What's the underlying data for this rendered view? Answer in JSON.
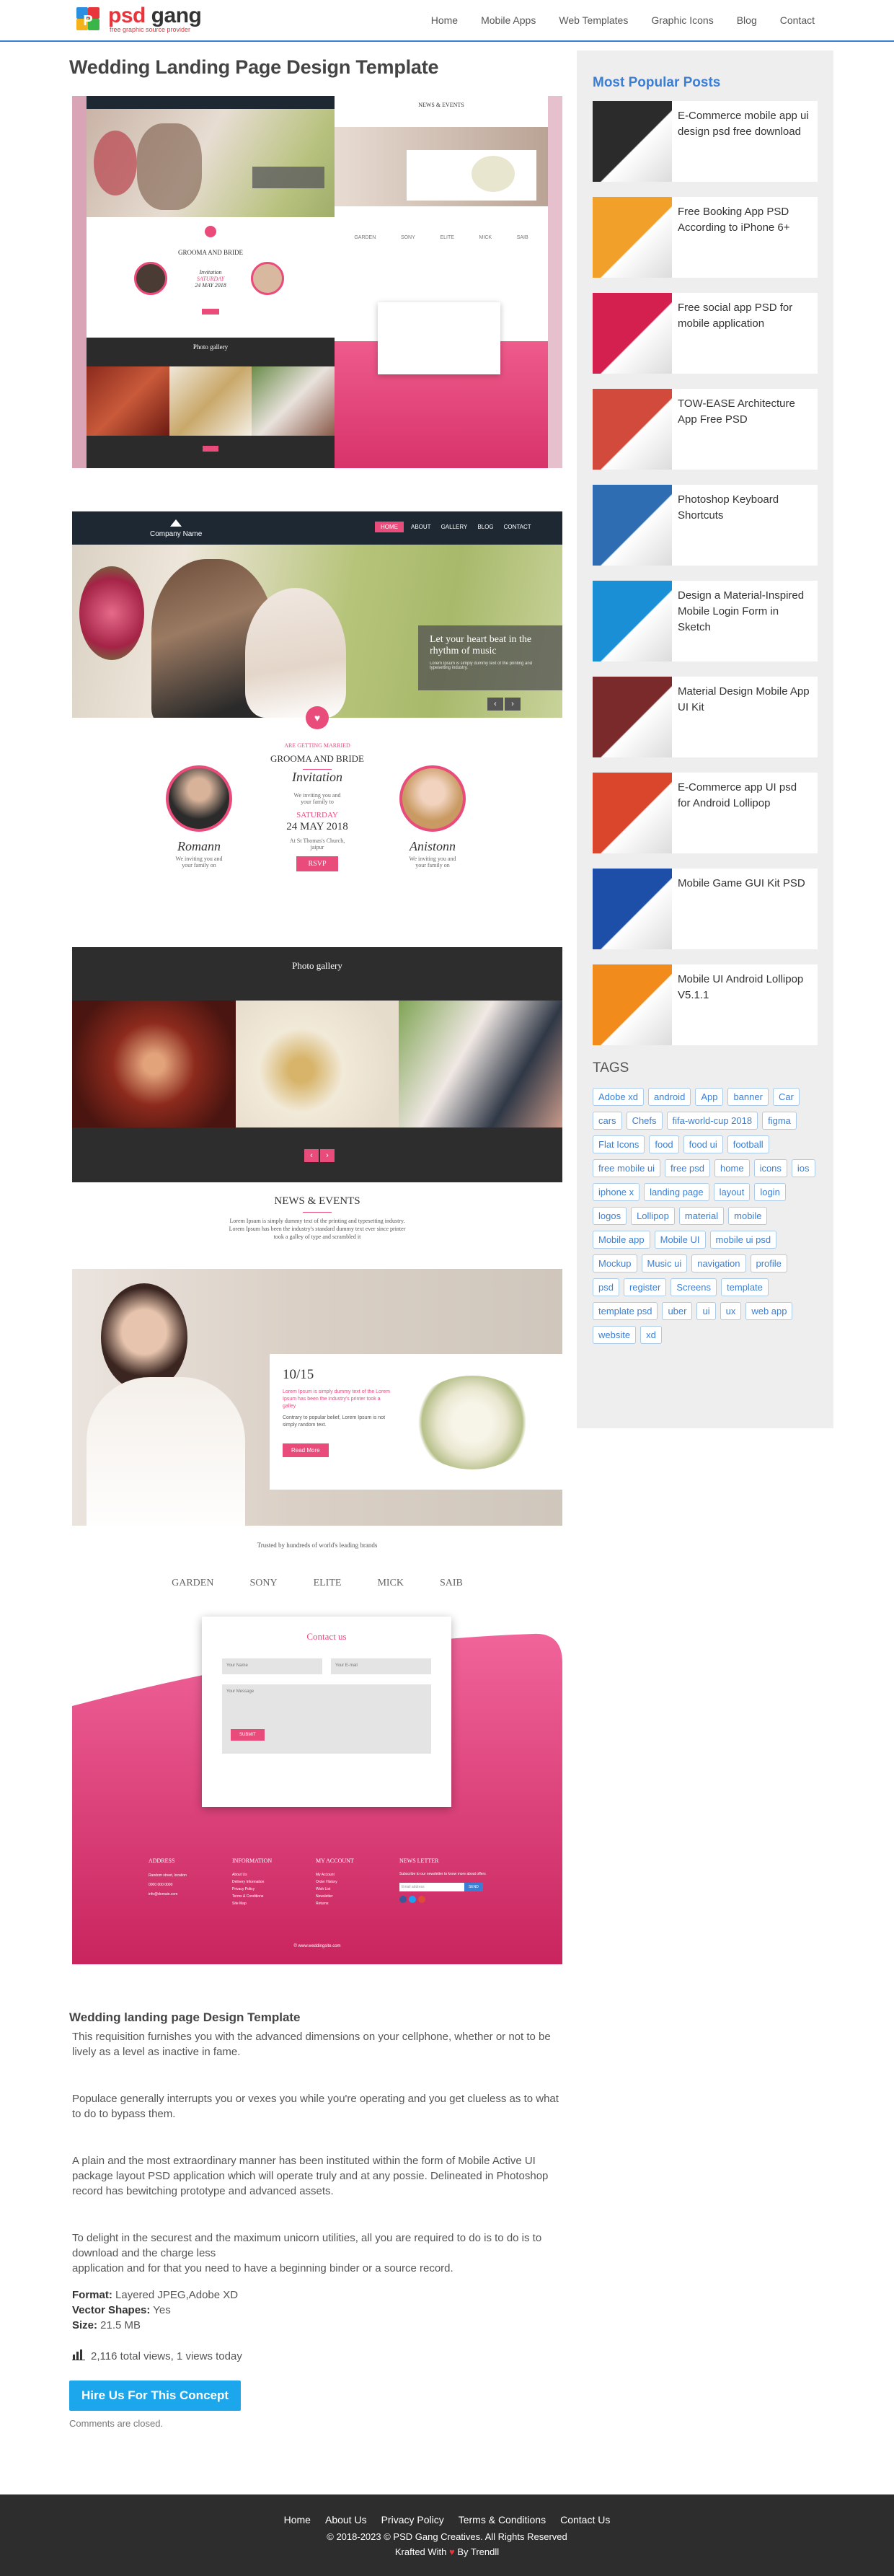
{
  "header": {
    "logo": {
      "name_part1": "psd",
      "name_part2": " gang",
      "tagline": "free graphic source provider"
    },
    "nav": [
      "Home",
      "Mobile Apps",
      "Web Templates",
      "Graphic Icons",
      "Blog",
      "Contact"
    ]
  },
  "main": {
    "title": "Wedding Landing Page Design Template"
  },
  "mockup": {
    "brand": "Company Name",
    "menu": [
      "HOME",
      "ABOUT",
      "GALLERY",
      "BLOG",
      "CONTACT"
    ],
    "hero_text": "Let your heart beat in the rhythm of music",
    "hero_sub": "Lorem Ipsum is simply dummy text of the printing and typesetting industry.",
    "kicker": "ARE GETTING MARRIED",
    "couple_title": "GROOMA AND BRIDE",
    "invitation": "Invitation",
    "invite_line": "We inviting you and your family to",
    "day": "SATURDAY",
    "date": "24 MAY 2018",
    "venue": "At St Thomas's Church, jaipur",
    "rsvp": "RSVP",
    "groom_name": "Romann",
    "bride_name": "Anistonn",
    "name_sub": "We inviting you and your family on",
    "gallery_title": "Photo gallery",
    "news_title": "NEWS & EVENTS",
    "news_text": "Lorem Ipsum is simply dummy text of the printing and typesetting industry. Lorem Ipsum has been the industry's standard dummy text ever since printer took a galley of type and scrambled it",
    "event_date": "10/15",
    "event_text": "Lorem Ipsum is simply dummy text of the Lorem Ipsum has been the industry's printer took a galley",
    "event_text2": "Contrary to popular belief, Lorem Ipsum is not simply random text.",
    "read_more": "Read More",
    "brands_title": "Trusted by hundreds of world's leading brands",
    "brands": [
      "GARDEN",
      "SONY",
      "ELITE",
      "MICK",
      "SAIB"
    ],
    "contact_title": "Contact us",
    "contact_fields": {
      "name": "Your Name",
      "email": "Your E-mail",
      "message": "Your Message"
    },
    "submit": "SUBMIT",
    "footer_cols": [
      {
        "h": "ADDRESS",
        "items": [
          "Random street, location",
          "0000 000 0000",
          "info@domain.com"
        ]
      },
      {
        "h": "INFORMATION",
        "items": [
          "About Us",
          "Delivery Information",
          "Privacy Policy",
          "Terms & Conditions",
          "Site Map"
        ]
      },
      {
        "h": "MY ACCOUNT",
        "items": [
          "My Account",
          "Order History",
          "Wish List",
          "Newsletter",
          "Returns"
        ]
      },
      {
        "h": "NEWS LETTER",
        "items": [
          "Subscribe to our newsletter to know more about offers"
        ]
      }
    ],
    "subscribe": "SEND",
    "email_ph": "Email address",
    "copyright": "© www.weddingsite.com"
  },
  "description": {
    "heading": "Wedding landing page Design Template",
    "paragraphs": [
      "This requisition furnishes you with the advanced dimensions on your cellphone, whether or not to be lively as a level as inactive in fame.",
      "Populace generally interrupts you or vexes you while you're operating and you get clueless as to what to do to bypass them.",
      "A plain and the most extraordinary manner has been instituted within the form of Mobile Active UI package layout PSD application which will operate truly and at any possie. Delineated in Photoshop record has bewitching prototype and advanced assets.",
      "To delight in the securest and the maximum unicorn utilities, all you are required to do is to do is to download and the charge less\napplication and for that you need to have a beginning binder or a source record."
    ],
    "format_label": "Format:",
    "format_value": " Layered JPEG,Adobe XD",
    "vector_label": "Vector Shapes:",
    "vector_value": " Yes",
    "size_label": "Size:",
    "size_value": " 21.5 MB",
    "views": "2,116 total views,  1 views today",
    "hire_button": "Hire Us For This Concept",
    "comments_closed": "Comments are closed."
  },
  "sidebar": {
    "popular_heading": "Most Popular Posts",
    "posts": [
      {
        "title": "E-Commerce mobile app ui design psd free download",
        "color": "#2b2b2b"
      },
      {
        "title": "Free Booking App PSD According to iPhone 6+",
        "color": "#f1a12a"
      },
      {
        "title": "Free social app PSD for mobile application",
        "color": "#d4204f"
      },
      {
        "title": "TOW-EASE Architecture App Free PSD",
        "color": "#d24a3b"
      },
      {
        "title": "Photoshop Keyboard Shortcuts",
        "color": "#2f6db3"
      },
      {
        "title": "Design a Material-Inspired Mobile Login Form in Sketch",
        "color": "#1b8fd6"
      },
      {
        "title": "Material Design Mobile App UI Kit",
        "color": "#7a2a2a"
      },
      {
        "title": "E-Commerce app UI psd for Android Lollipop",
        "color": "#d9462b"
      },
      {
        "title": "Mobile Game GUI Kit PSD",
        "color": "#1d4fa8"
      },
      {
        "title": "Mobile UI Android Lollipop V5.1.1",
        "color": "#f08b1c"
      }
    ],
    "tags_heading": "TAGS",
    "tags": [
      "Adobe xd",
      "android",
      "App",
      "banner",
      "Car",
      "cars",
      "Chefs",
      "fifa-world-cup 2018",
      "figma",
      "Flat Icons",
      "food",
      "food ui",
      "football",
      "free mobile ui",
      "free psd",
      "home",
      "icons",
      "ios",
      "iphone x",
      "landing page",
      "layout",
      "login",
      "logos",
      "Lollipop",
      "material",
      "mobile",
      "Mobile app",
      "Mobile UI",
      "mobile ui psd",
      "Mockup",
      "Music ui",
      "navigation",
      "profile",
      "psd",
      "register",
      "Screens",
      "template",
      "template psd",
      "uber",
      "ui",
      "ux",
      "web app",
      "website",
      "xd"
    ]
  },
  "footer": {
    "links": [
      "Home",
      "About Us",
      "Privacy Policy",
      "Terms & Conditions",
      "Contact Us"
    ],
    "copyright": "© 2018-2023 © PSD Gang Creatives. All Rights Reserved",
    "made_prefix": "Krafted With ",
    "made_suffix": " By Trendll"
  },
  "colors": {
    "accent": "#3b7fd4",
    "pink": "#e94b7b",
    "hire": "#1ca7ec"
  }
}
